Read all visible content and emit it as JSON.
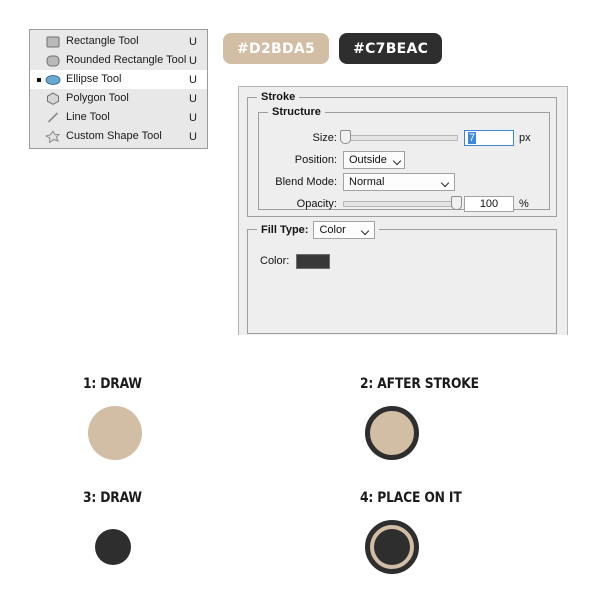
{
  "tool_panel": {
    "items": [
      {
        "icon": "rectangle-tool-icon",
        "label": "Rectangle Tool",
        "shortcut": "U",
        "selected": false
      },
      {
        "icon": "rounded-rectangle-tool-icon",
        "label": "Rounded Rectangle Tool",
        "shortcut": "U",
        "selected": false
      },
      {
        "icon": "ellipse-tool-icon",
        "label": "Ellipse Tool",
        "shortcut": "U",
        "selected": true
      },
      {
        "icon": "polygon-tool-icon",
        "label": "Polygon Tool",
        "shortcut": "U",
        "selected": false
      },
      {
        "icon": "line-tool-icon",
        "label": "Line Tool",
        "shortcut": "U",
        "selected": false
      },
      {
        "icon": "custom-shape-tool-icon",
        "label": "Custom Shape Tool",
        "shortcut": "U",
        "selected": false
      }
    ]
  },
  "swatches": [
    {
      "label": "#D2BDA5",
      "background": "#D2BDA5",
      "text_color": "#ffffff"
    },
    {
      "label": "#C7BEAC",
      "background": "#2E2E2E",
      "text_color": "#ffffff"
    }
  ],
  "stroke_dialog": {
    "group_title": "Stroke",
    "structure": {
      "group_title": "Structure",
      "size": {
        "label": "Size:",
        "value": "7",
        "unit": "px",
        "slider_percent": 2
      },
      "position": {
        "label": "Position:",
        "value": "Outside"
      },
      "blend_mode": {
        "label": "Blend Mode:",
        "value": "Normal"
      },
      "opacity": {
        "label": "Opacity:",
        "value": "100",
        "unit": "%",
        "slider_percent": 100
      }
    },
    "fill": {
      "group_title": "Fill Type:",
      "fill_type_value": "Color",
      "color_label": "Color:",
      "color_value": "#383838"
    }
  },
  "steps": [
    {
      "title": "1: DRAW",
      "fill": "#D2BDA5",
      "stroke": "none",
      "inner": "none"
    },
    {
      "title": "2: AFTER STROKE",
      "fill": "#D2BDA5",
      "stroke": "#2E2E2E",
      "inner": "none"
    },
    {
      "title": "3: DRAW",
      "fill": "#2E2E2E",
      "stroke": "none",
      "inner": "none"
    },
    {
      "title": "4: PLACE ON IT",
      "fill": "#D2BDA5",
      "stroke": "#2E2E2E",
      "inner": "#2E2E2E"
    }
  ]
}
